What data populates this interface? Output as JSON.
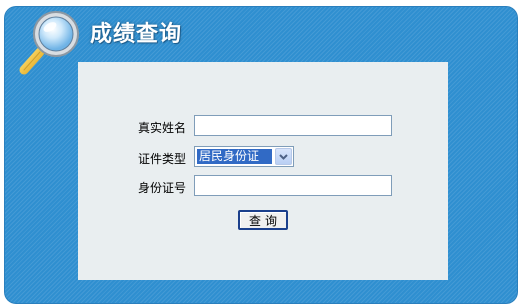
{
  "header": {
    "title": "成绩查询",
    "logo_icon": "magnifier-icon"
  },
  "form": {
    "name_label": "真实姓名",
    "name_value": "",
    "id_type_label": "证件类型",
    "id_type_selected": "居民身份证",
    "id_number_label": "身份证号",
    "id_number_value": "",
    "submit_label": "查询"
  },
  "colors": {
    "panel_blue": "#2f8fd0",
    "card_bg": "#e9eef0",
    "selection_blue": "#316ac5"
  }
}
